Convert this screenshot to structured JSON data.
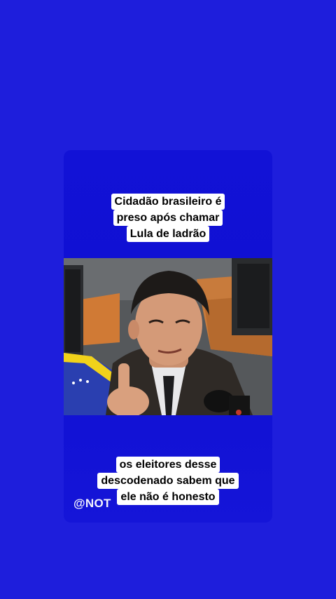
{
  "caption_top": {
    "lines": [
      "Cidadão brasileiro é",
      "preso após chamar",
      "Lula de ladrão"
    ]
  },
  "caption_bottom": {
    "lines": [
      "os eleitores desse",
      "descodenado sabem que",
      "ele não é honesto"
    ]
  },
  "watermark": "@NOT",
  "video": {
    "description_icon": "video-frame-icon"
  }
}
